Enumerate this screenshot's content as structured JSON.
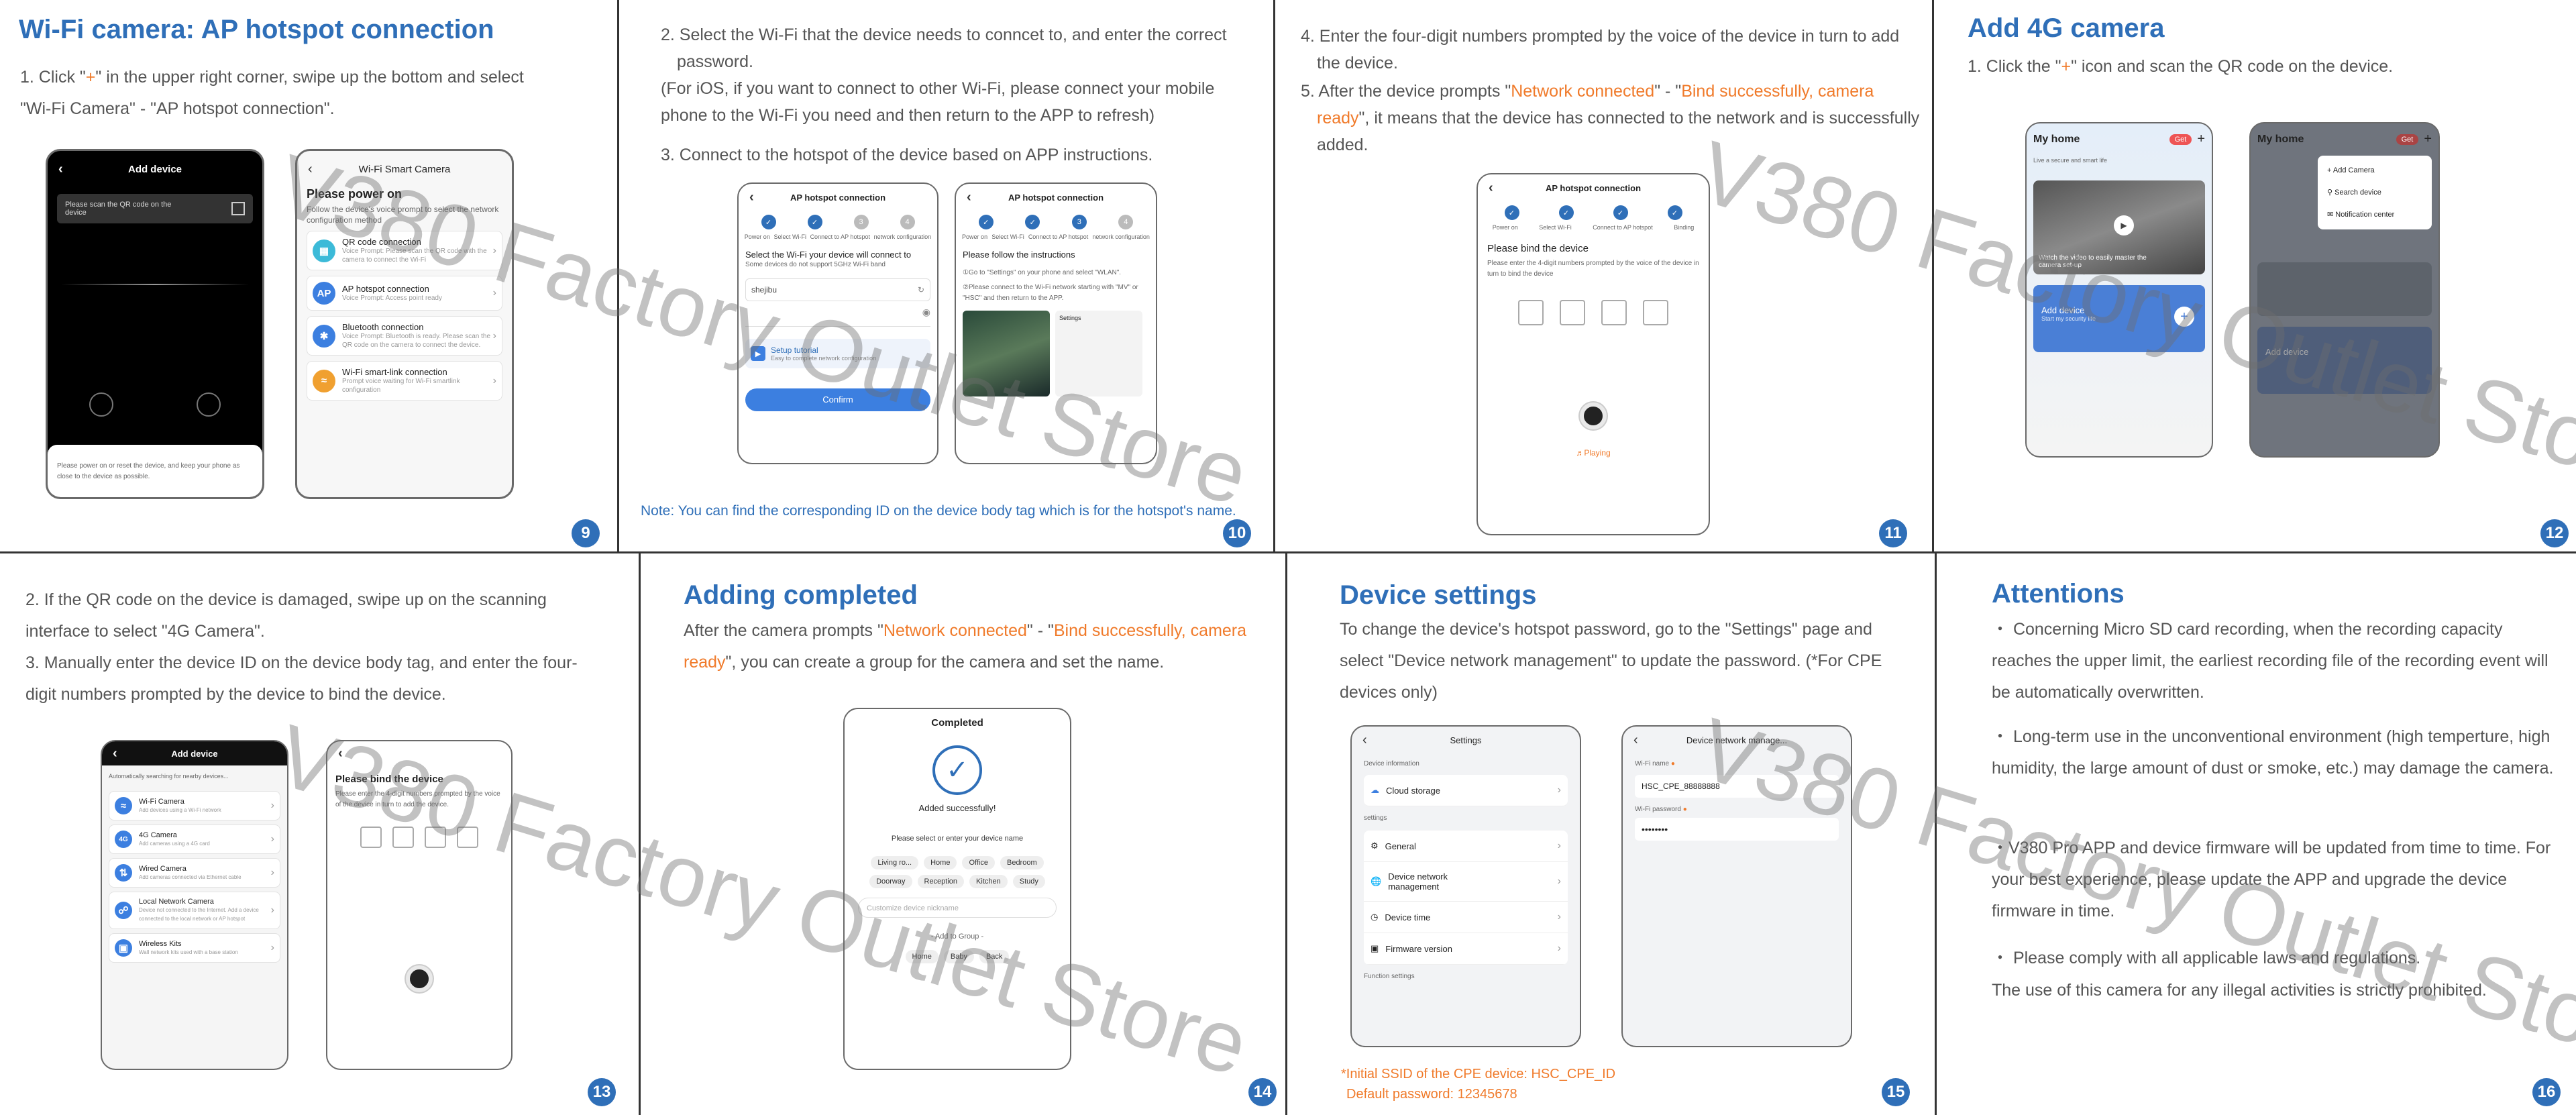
{
  "watermark_text": "V380 Factory Outlet Store",
  "colors": {
    "accent": "#2f6fb8",
    "highlight": "#f07a2a"
  },
  "p9": {
    "num": "9",
    "title": "Wi-Fi camera: AP hotspot connection",
    "step_a": "1. Click \"",
    "step_plus": "+",
    "step_b": "\" in the upper right corner, swipe up the bottom and select",
    "step_c": "\"Wi-Fi Camera\" - \"AP hotspot connection\".",
    "phone1": {
      "title": "Add device",
      "scan_hint": "Please scan the QR code on the device",
      "bottom_text": "Please power on or reset the device, and keep your phone as close to the device as possible."
    },
    "phone2": {
      "title": "Wi-Fi Smart Camera",
      "heading": "Please power on",
      "sub": "Follow the device's voice prompt to select the network configuration method",
      "options": [
        {
          "icon": "qr-icon",
          "title": "QR code connection",
          "sub": "Voice Prompt: Please scan the QR code with the camera to connect the Wi-Fi"
        },
        {
          "icon": "ap-icon",
          "title": "AP hotspot connection",
          "sub": "Voice Prompt: Access point ready"
        },
        {
          "icon": "bluetooth-icon",
          "title": "Bluetooth connection",
          "sub": "Voice Prompt: Bluetooth is ready. Please scan the QR code on the camera to connect the device."
        },
        {
          "icon": "wifi-icon",
          "title": "Wi-Fi smart-link connection",
          "sub": "Prompt voice waiting for Wi-Fi smartlink configuration"
        }
      ]
    }
  },
  "p10": {
    "num": "10",
    "step2": "2.  Select the Wi-Fi that the device needs to conncet to, and enter the correct password.",
    "ios": "(For iOS, if you want to connect to other Wi-Fi, please connect your mobile phone to the Wi-Fi you need and then return to the APP to refresh)",
    "step3": "3. Connect to the hotspot of the device based on APP instructions.",
    "note": "Note: You can find the corresponding ID on the device body tag which is for the hotspot's name.",
    "phoneA": {
      "title": "AP hotspot connection",
      "steps": [
        "Power on",
        "Select Wi-Fi",
        "Connect to AP hotspot",
        "network configuration"
      ],
      "heading": "Select the Wi-Fi your device will connect to",
      "sub": "Some devices do not support 5GHz Wi-Fi band",
      "wifi": "shejibu",
      "tutorial": "Setup tutorial",
      "tutorial_sub": "Easy to complete network configuration",
      "confirm": "Confirm"
    },
    "phoneB": {
      "title": "AP hotspot connection",
      "steps": [
        "Power on",
        "Select Wi-Fi",
        "Connect to AP hotspot",
        "network configuration"
      ],
      "heading": "Please follow the instructions",
      "inst1": "①Go to \"Settings\" on your phone and select \"WLAN\".",
      "inst2": "②Please connect to the Wi-Fi network starting with \"MV\" or \"HSC\" and then return to the APP.",
      "settings": "Settings"
    }
  },
  "p11": {
    "num": "11",
    "step4": "4. Enter the four-digit numbers prompted by the voice of the device in turn to add the device.",
    "s5a": "5. After the device prompts \"",
    "s5_nc": "Network connected",
    "s5b": "\" - \"",
    "s5_bind": "Bind successfully, camera ready",
    "s5c": "\", it means that the device has connected to the network and is successfully added.",
    "phone": {
      "title": "AP hotspot connection",
      "steps": [
        "Power on",
        "Select Wi-Fi",
        "Connect to AP hotspot",
        "Binding"
      ],
      "heading": "Please bind the device",
      "sub": "Please enter the 4-digit numbers prompted by the voice of the device in turn to bind the device",
      "playing": "Playing"
    }
  },
  "p12": {
    "num": "12",
    "title": "Add 4G camera",
    "step_a": "1. Click the \"",
    "step_plus": "+",
    "step_b": "\" icon and scan the QR code on the device.",
    "phone": {
      "home": "My home",
      "get": "Get",
      "live": "Live a secure and smart life",
      "video": "Watch the video to easily master the camera set-up",
      "add": "Add device",
      "add_sub": "Start my security life"
    },
    "menu": [
      "Add Camera",
      "Search device",
      "Notification center"
    ]
  },
  "p13": {
    "num": "13",
    "step2": "2. If the QR code on the device is damaged, swipe up on the scanning interface to select \"4G Camera\".",
    "step3": "3. Manually enter the device ID on the device body tag, and enter the four-digit numbers prompted by the device to bind the device.",
    "phoneA": {
      "title": "Add device",
      "auto": "Automatically searching for nearby devices...",
      "options": [
        {
          "title": "Wi-Fi Camera",
          "sub": "Add devices using a Wi-Fi network"
        },
        {
          "title": "4G Camera",
          "sub": "Add cameras using a 4G card"
        },
        {
          "title": "Wired Camera",
          "sub": "Add cameras connected via Ethernet cable"
        },
        {
          "title": "Local Network Camera",
          "sub": "Device not connected to the Internet. Add a device connected to the local network or AP hotspot"
        },
        {
          "title": "Wireless Kits",
          "sub": "Wall network kits used with a base station"
        }
      ]
    },
    "phoneB": {
      "heading": "Please bind the device",
      "sub": "Please enter the 4-digit numbers prompted by the voice of the device in turn to add the device."
    }
  },
  "p14": {
    "num": "14",
    "title": "Adding completed",
    "t_a": "After the camera prompts \"",
    "t_nc": "Network connected",
    "t_b": "\" - \"",
    "t_bind": "Bind successfully, camera ready",
    "t_c": "\", you can create a group for the camera and set the name.",
    "phone": {
      "title": "Completed",
      "added": "Added successfully!",
      "prompt": "Please select or enter your device name",
      "chips": [
        "Living ro...",
        "Home",
        "Office",
        "Bedroom",
        "Doorway",
        "Reception",
        "Kitchen",
        "Study"
      ],
      "placeholder": "Customize device nickname",
      "group": "- Add to Group -",
      "groups": [
        "Home",
        "Baby",
        "Back"
      ]
    }
  },
  "p15": {
    "num": "15",
    "title": "Device settings",
    "text": "To change the device's hotspot password, go to the \"Settings\" page and select \"Device network management\" to update the password. (*For CPE devices only)",
    "note1": "*Initial SSID of the CPE device: HSC_CPE_ID",
    "note2": "Default password: 12345678",
    "phoneA": {
      "title": "Settings",
      "info": "Device information",
      "cloud": "Cloud storage",
      "settings": "settings",
      "items": [
        "General",
        "Device network management",
        "Device time",
        "Firmware version"
      ],
      "func": "Function settings"
    },
    "phoneB": {
      "title": "Device network manage...",
      "wifi_name": "Wi-Fi name",
      "ssid": "HSC_CPE_88888888",
      "wifi_pw": "Wi-Fi password",
      "pw": "••••••••"
    }
  },
  "p16": {
    "num": "16",
    "title": "Attentions",
    "items": [
      "・ Concerning Micro SD card recording, when the recording capacity reaches the upper limit, the earliest recording file of the recording event will be automatically overwritten.",
      "・ Long-term use in the unconventional environment (high temperture, high humidity, the large amount of dust or smoke, etc.) may damage the camera.",
      "・V380 Pro APP and device firmware will be updated from time to time. For your best experience, please update the APP and upgrade the device firmware in time.",
      "・ Please comply with all applicable laws and regulations."
    ],
    "last": "The use of this camera for any illegal activities is strictly prohibited."
  }
}
